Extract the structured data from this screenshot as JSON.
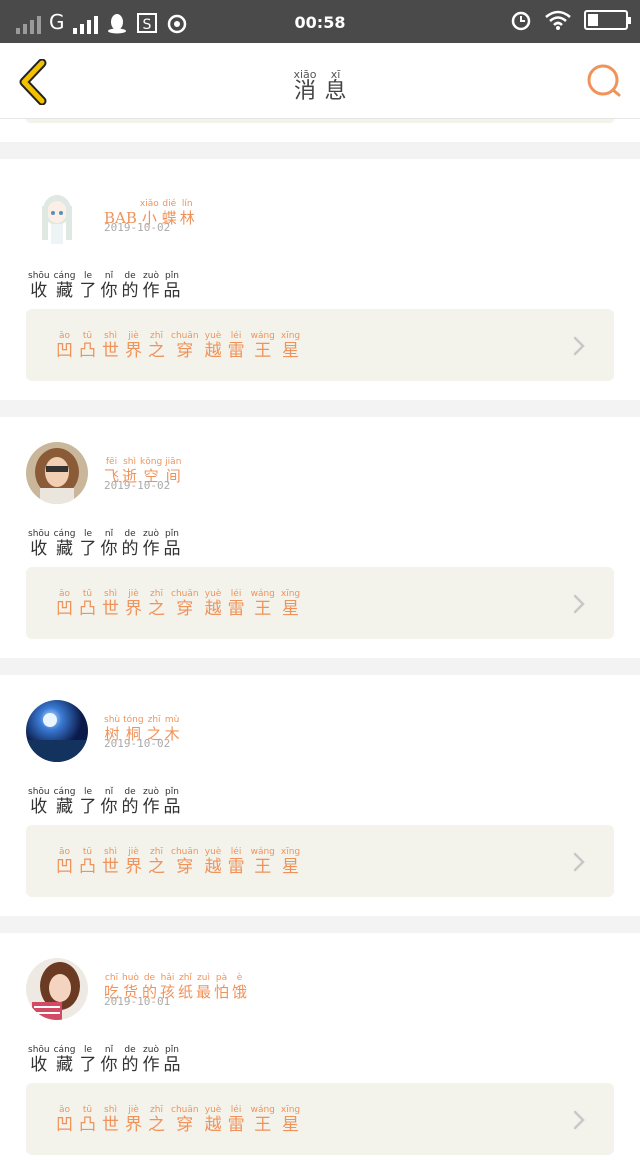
{
  "status_bar": {
    "carrier": "G",
    "time": "00:58"
  },
  "header": {
    "back_icon": "chevron-left-icon",
    "title": [
      {
        "py": "xiāo",
        "hz": "消"
      },
      {
        "py": "xī",
        "hz": "息"
      }
    ],
    "search_icon": "search-icon"
  },
  "colors": {
    "accent": "#f0935a",
    "back_arrow": "#f2c200",
    "status_bar": "#4a4a4a",
    "card_bg": "#f3f3ec"
  },
  "messages": [
    {
      "user_prefix": "BAB",
      "user": [
        {
          "py": "xiǎo",
          "hz": "小"
        },
        {
          "py": "dié",
          "hz": "蝶"
        },
        {
          "py": "lín",
          "hz": "林"
        }
      ],
      "date": "2019-10-02",
      "action": [
        {
          "py": "shōu",
          "hz": "收"
        },
        {
          "py": "cáng",
          "hz": "藏"
        },
        {
          "py": "le",
          "hz": "了"
        },
        {
          "py": "nǐ",
          "hz": "你"
        },
        {
          "py": "de",
          "hz": "的"
        },
        {
          "py": "zuò",
          "hz": "作"
        },
        {
          "py": "pǐn",
          "hz": "品"
        }
      ],
      "work": [
        {
          "py": "āo",
          "hz": "凹"
        },
        {
          "py": "tū",
          "hz": "凸"
        },
        {
          "py": "shì",
          "hz": "世"
        },
        {
          "py": "jiè",
          "hz": "界"
        },
        {
          "py": "zhī",
          "hz": "之"
        },
        {
          "py": "chuān",
          "hz": "穿"
        },
        {
          "py": "yuè",
          "hz": "越"
        },
        {
          "py": "léi",
          "hz": "雷"
        },
        {
          "py": "wáng",
          "hz": "王"
        },
        {
          "py": "xīng",
          "hz": "星"
        }
      ]
    },
    {
      "user_prefix": "",
      "user": [
        {
          "py": "fēi",
          "hz": "飞"
        },
        {
          "py": "shì",
          "hz": "逝"
        },
        {
          "py": "kōng",
          "hz": "空"
        },
        {
          "py": "jiān",
          "hz": "间"
        }
      ],
      "date": "2019-10-02",
      "action": [
        {
          "py": "shōu",
          "hz": "收"
        },
        {
          "py": "cáng",
          "hz": "藏"
        },
        {
          "py": "le",
          "hz": "了"
        },
        {
          "py": "nǐ",
          "hz": "你"
        },
        {
          "py": "de",
          "hz": "的"
        },
        {
          "py": "zuò",
          "hz": "作"
        },
        {
          "py": "pǐn",
          "hz": "品"
        }
      ],
      "work": [
        {
          "py": "āo",
          "hz": "凹"
        },
        {
          "py": "tū",
          "hz": "凸"
        },
        {
          "py": "shì",
          "hz": "世"
        },
        {
          "py": "jiè",
          "hz": "界"
        },
        {
          "py": "zhī",
          "hz": "之"
        },
        {
          "py": "chuān",
          "hz": "穿"
        },
        {
          "py": "yuè",
          "hz": "越"
        },
        {
          "py": "léi",
          "hz": "雷"
        },
        {
          "py": "wáng",
          "hz": "王"
        },
        {
          "py": "xīng",
          "hz": "星"
        }
      ]
    },
    {
      "user_prefix": "",
      "user": [
        {
          "py": "shù",
          "hz": "树"
        },
        {
          "py": "tóng",
          "hz": "桐"
        },
        {
          "py": "zhī",
          "hz": "之"
        },
        {
          "py": "mù",
          "hz": "木"
        }
      ],
      "date": "2019-10-02",
      "action": [
        {
          "py": "shōu",
          "hz": "收"
        },
        {
          "py": "cáng",
          "hz": "藏"
        },
        {
          "py": "le",
          "hz": "了"
        },
        {
          "py": "nǐ",
          "hz": "你"
        },
        {
          "py": "de",
          "hz": "的"
        },
        {
          "py": "zuò",
          "hz": "作"
        },
        {
          "py": "pǐn",
          "hz": "品"
        }
      ],
      "work": [
        {
          "py": "āo",
          "hz": "凹"
        },
        {
          "py": "tū",
          "hz": "凸"
        },
        {
          "py": "shì",
          "hz": "世"
        },
        {
          "py": "jiè",
          "hz": "界"
        },
        {
          "py": "zhī",
          "hz": "之"
        },
        {
          "py": "chuān",
          "hz": "穿"
        },
        {
          "py": "yuè",
          "hz": "越"
        },
        {
          "py": "léi",
          "hz": "雷"
        },
        {
          "py": "wáng",
          "hz": "王"
        },
        {
          "py": "xīng",
          "hz": "星"
        }
      ]
    },
    {
      "user_prefix": "",
      "user": [
        {
          "py": "chī",
          "hz": "吃"
        },
        {
          "py": "huò",
          "hz": "货"
        },
        {
          "py": "de",
          "hz": "的"
        },
        {
          "py": "hǎi",
          "hz": "孩"
        },
        {
          "py": "zhǐ",
          "hz": "纸"
        },
        {
          "py": "zuì",
          "hz": "最"
        },
        {
          "py": "pà",
          "hz": "怕"
        },
        {
          "py": "è",
          "hz": "饿"
        }
      ],
      "date": "2019-10-01",
      "action": [
        {
          "py": "shōu",
          "hz": "收"
        },
        {
          "py": "cáng",
          "hz": "藏"
        },
        {
          "py": "le",
          "hz": "了"
        },
        {
          "py": "nǐ",
          "hz": "你"
        },
        {
          "py": "de",
          "hz": "的"
        },
        {
          "py": "zuò",
          "hz": "作"
        },
        {
          "py": "pǐn",
          "hz": "品"
        }
      ],
      "work": [
        {
          "py": "āo",
          "hz": "凹"
        },
        {
          "py": "tū",
          "hz": "凸"
        },
        {
          "py": "shì",
          "hz": "世"
        },
        {
          "py": "jiè",
          "hz": "界"
        },
        {
          "py": "zhī",
          "hz": "之"
        },
        {
          "py": "chuān",
          "hz": "穿"
        },
        {
          "py": "yuè",
          "hz": "越"
        },
        {
          "py": "léi",
          "hz": "雷"
        },
        {
          "py": "wáng",
          "hz": "王"
        },
        {
          "py": "xīng",
          "hz": "星"
        }
      ]
    }
  ]
}
